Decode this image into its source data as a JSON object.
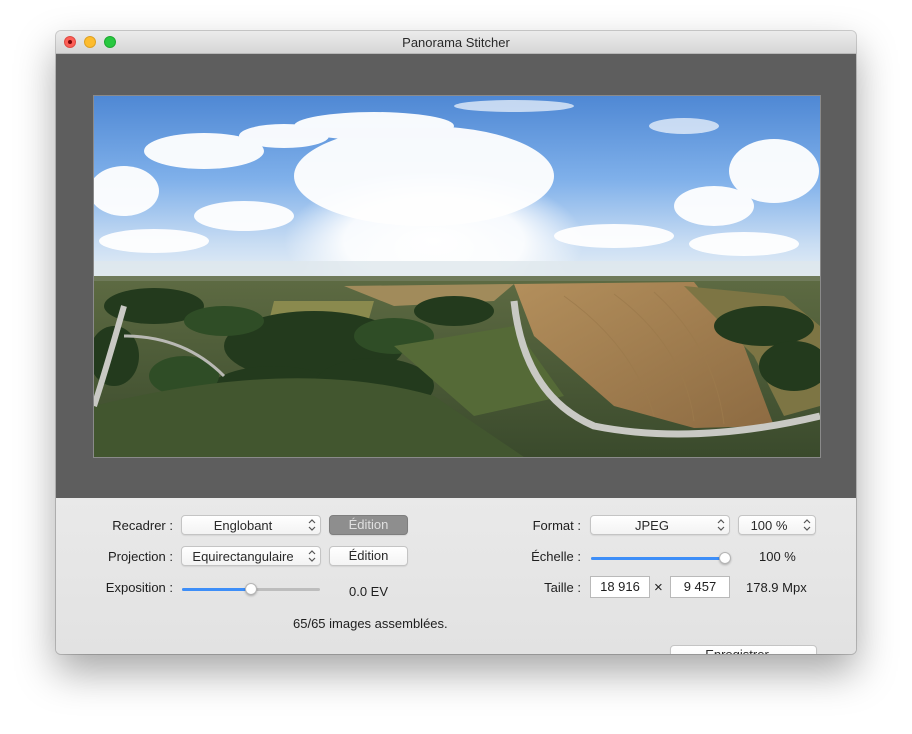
{
  "window": {
    "title": "Panorama Stitcher"
  },
  "controls": {
    "crop": {
      "label": "Recadrer :",
      "value": "Englobant",
      "edit_label": "Édition"
    },
    "projection": {
      "label": "Projection :",
      "value": "Equirectangulaire",
      "edit_label": "Édition"
    },
    "exposure": {
      "label": "Exposition :",
      "value_text": "0.0 EV",
      "slider_fraction": 0.5
    },
    "status": "65/65 images assemblées.",
    "format": {
      "label": "Format :",
      "value": "JPEG",
      "quality": "100 %"
    },
    "scale": {
      "label": "Échelle :",
      "value_text": "100 %",
      "slider_fraction": 1.0
    },
    "size": {
      "label": "Taille :",
      "width": "18 916",
      "times": "×",
      "height": "9 457",
      "megapixels": "178.9 Mpx"
    },
    "save_label": "Enregistrer…"
  },
  "colors": {
    "accent": "#3d8ef8",
    "viewer_bg": "#5e5e5e"
  }
}
